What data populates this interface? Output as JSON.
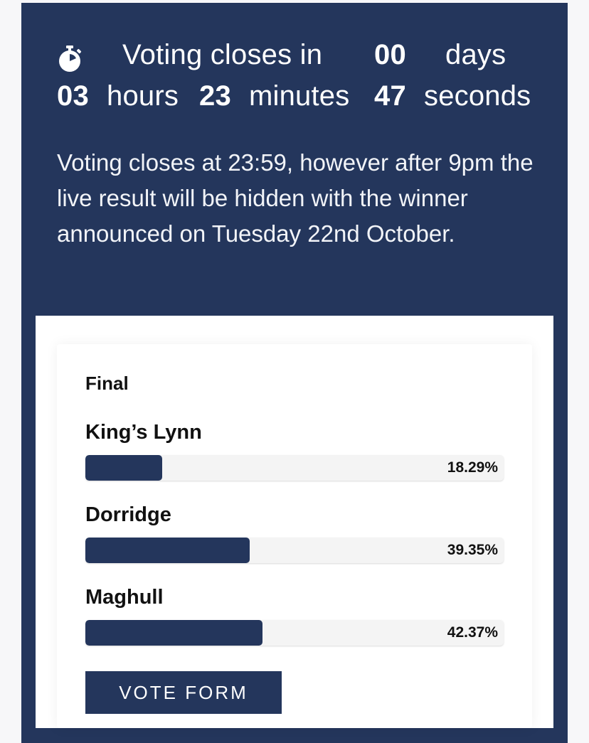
{
  "countdown": {
    "icon": "stopwatch-icon",
    "prefix": "Voting closes in",
    "days_value": "00",
    "days_label": "days",
    "hours_value": "03",
    "hours_label": "hours",
    "minutes_value": "23",
    "minutes_label": "minutes",
    "seconds_value": "47",
    "seconds_label": "seconds"
  },
  "notice": "Voting closes at 23:59, however after 9pm the live result will be hidden with the winner announced on Tuesday 22nd October.",
  "poll": {
    "title": "Final",
    "options": [
      {
        "label": "King’s Lynn",
        "percent_text": "18.29%",
        "percent": 18.29
      },
      {
        "label": "Dorridge",
        "percent_text": "39.35%",
        "percent": 39.35
      },
      {
        "label": "Maghull",
        "percent_text": "42.37%",
        "percent": 42.37
      }
    ],
    "button_label": "VOTE FORM"
  },
  "colors": {
    "brand_navy": "#24365c",
    "page_background": "#f7f7f9",
    "bar_track": "#f4f4f4"
  }
}
